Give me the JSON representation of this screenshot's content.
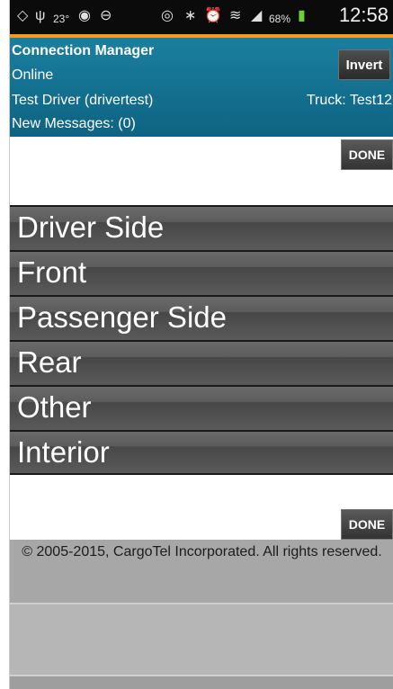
{
  "status_bar": {
    "icons": [
      "gps-icon",
      "usb-icon",
      "temperature-icon",
      "sync-icon",
      "minus-circle-icon",
      "eye-icon",
      "bluetooth-icon",
      "alarm-icon",
      "wifi-icon",
      "signal-icon",
      "battery-icon"
    ],
    "temperature": "23°",
    "battery_percent": "68%",
    "time": "12:58"
  },
  "header": {
    "title": "Connection Manager",
    "status": "Online",
    "driver": "Test Driver (drivertest)",
    "truck": "Truck: Test12",
    "messages": "New Messages: (0)",
    "invert_label": "Invert",
    "background_color": "#0e6382"
  },
  "done_label": "DONE",
  "options": [
    {
      "label": "Driver Side"
    },
    {
      "label": "Front"
    },
    {
      "label": "Passenger Side"
    },
    {
      "label": "Rear"
    },
    {
      "label": "Other"
    },
    {
      "label": "Interior"
    }
  ],
  "footer": {
    "copyright": "© 2005-2015, CargoTel Incorporated. All rights reserved."
  },
  "colors": {
    "accent_orange": "#f39a1f",
    "button_gray": "#333333"
  }
}
